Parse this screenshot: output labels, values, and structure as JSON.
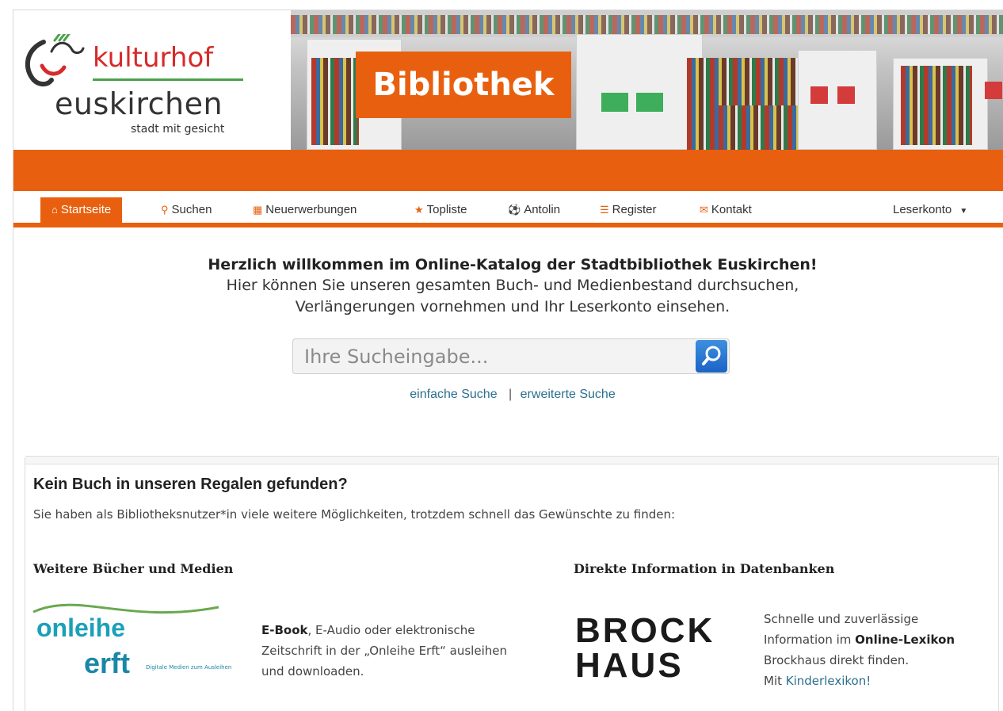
{
  "logo": {
    "name_top": "kulturhof",
    "name_main": "euskirchen",
    "slogan": "stadt mit gesicht"
  },
  "banner": {
    "title": "Bibliothek"
  },
  "nav": {
    "items": [
      {
        "label": "Startseite",
        "icon": "home-icon"
      },
      {
        "label": "Suchen",
        "icon": "search-icon"
      },
      {
        "label": "Neuerwerbungen",
        "icon": "calendar-icon"
      },
      {
        "label": "Topliste",
        "icon": "star-icon"
      },
      {
        "label": "Antolin",
        "icon": "ball-icon"
      },
      {
        "label": "Register",
        "icon": "list-icon"
      },
      {
        "label": "Kontakt",
        "icon": "mail-icon"
      }
    ],
    "account": "Leserkonto"
  },
  "welcome": {
    "title": "Herzlich willkommen im Online-Katalog der Stadtbibliothek Euskirchen!",
    "line1": "Hier können Sie unseren gesamten Buch- und Medienbestand durchsuchen,",
    "line2": "Verlängerungen vornehmen und Ihr Leserkonto einsehen."
  },
  "search": {
    "placeholder": "Ihre Sucheingabe...",
    "simple": "einfache Suche",
    "separator": "|",
    "advanced": "erweiterte Suche"
  },
  "panel": {
    "title": "Kein Buch in unseren Regalen gefunden?",
    "subtitle": "Sie haben als Bibliotheksnutzer*in viele weitere Möglichkeiten, trotzdem schnell das Gewünschte zu finden:",
    "left": {
      "heading": "Weitere Bücher und Medien",
      "logo_line1": "onleihe",
      "logo_line2": "erft",
      "logo_tagline": "Digitale Medien zum Ausleihen",
      "bold": "E-Book",
      "text1": ", E-Audio oder elektronische",
      "text2": "Zeitschrift in der „Onleihe Erft“ ausleihen",
      "text3": "und downloaden."
    },
    "right": {
      "heading": "Direkte Information in Datenbanken",
      "logo_line1": "BROCK",
      "logo_line2": "HAUS",
      "text1": "Schnelle und zuverlässige",
      "text2a": "Information im ",
      "text2b": "Online-Lexikon",
      "text3": "Brockhaus direkt finden.",
      "text4a": "Mit ",
      "text4b": "Kinderlexikon!"
    }
  },
  "colors": {
    "accent": "#e8600f",
    "brand_red": "#d62a2a",
    "brand_green": "#4aa14a",
    "link": "#2b6f8f"
  }
}
